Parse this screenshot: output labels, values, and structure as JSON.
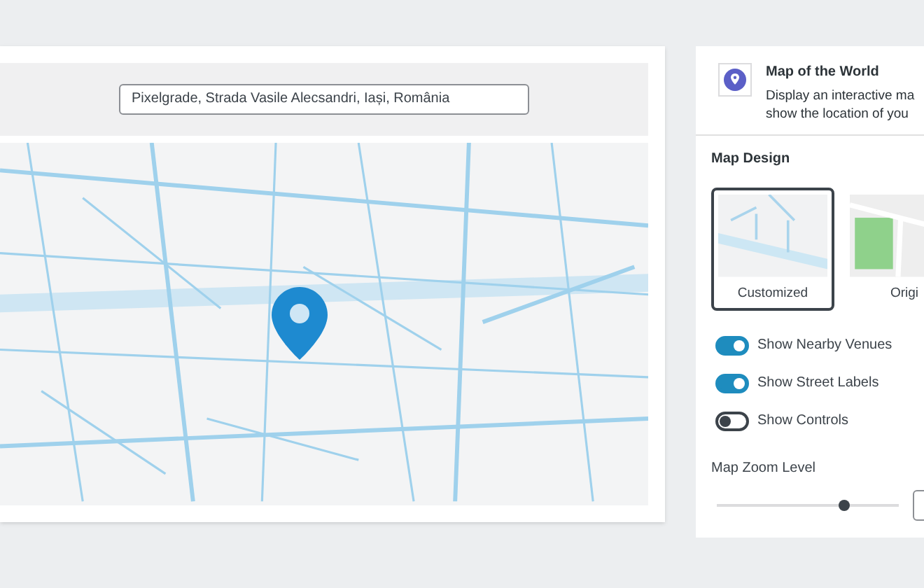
{
  "location_search": {
    "value": "Pixelgrade, Strada Vasile Alecsandri, Iași, România"
  },
  "block": {
    "title": "Map of the World",
    "description_lines": [
      "Display an interactive ma",
      "show the location of you"
    ]
  },
  "map_design": {
    "heading": "Map Design",
    "styles": [
      {
        "label": "Customized",
        "kind": "customized",
        "selected": true
      },
      {
        "label": "Origi",
        "kind": "original",
        "selected": false
      }
    ]
  },
  "toggles": [
    {
      "label": "Show Nearby Venues",
      "on": true
    },
    {
      "label": "Show Street Labels",
      "on": true
    },
    {
      "label": "Show Controls",
      "on": false
    }
  ],
  "zoom": {
    "label": "Map Zoom Level",
    "level": 0.7
  }
}
